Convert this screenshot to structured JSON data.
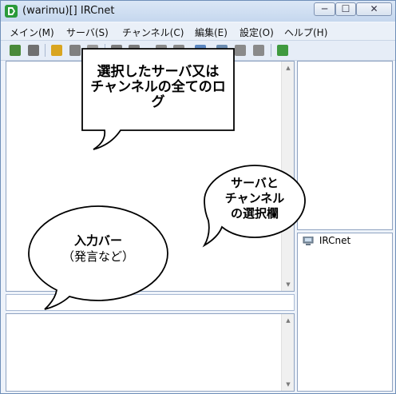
{
  "window": {
    "title": "(warimu)[] IRCnet",
    "controls": {
      "minimize": "─",
      "maximize": "☐",
      "close": "✕"
    }
  },
  "menu": [
    {
      "label": "メイン(M)"
    },
    {
      "label": "サーバ(S)"
    },
    {
      "label": "チャンネル(C)"
    },
    {
      "label": "編集(E)"
    },
    {
      "label": "設定(O)"
    },
    {
      "label": "ヘルプ(H)"
    }
  ],
  "toolbar": {
    "icons": [
      "connect-icon",
      "disconnect-icon",
      "open-folder-icon",
      "save-icon",
      "settings-icon",
      "list-icon",
      "window-icon",
      "key-icon",
      "user-icon",
      "check-icon",
      "search-icon",
      "bird-icon",
      "lock-icon",
      "export-icon"
    ],
    "colors": [
      "#4a8a3a",
      "#707070",
      "#d9a520",
      "#808080",
      "#9a9a9a",
      "#7b7b7b",
      "#7b7b7b",
      "#8a8a8a",
      "#8a8a8a",
      "#5a86c0",
      "#6a8bb0",
      "#8a8a8a",
      "#8a8a8a",
      "#3f9a3f"
    ]
  },
  "channel_tree": {
    "root": "IRCnet",
    "root_icon": "computer-icon"
  },
  "callouts": {
    "log": [
      "選択したサーバ又は",
      "チャンネルの全てのロ",
      "グ"
    ],
    "tree": [
      "サーバと",
      "チャンネル",
      "の選択欄"
    ],
    "input": [
      "入力バー",
      "（発言など）"
    ]
  },
  "scroll": {
    "up": "▲",
    "down": "▼"
  },
  "colors": {
    "accent": "#2a9a3a",
    "frame": "#6f8fb8",
    "titlebar": "#c5d7ee"
  }
}
